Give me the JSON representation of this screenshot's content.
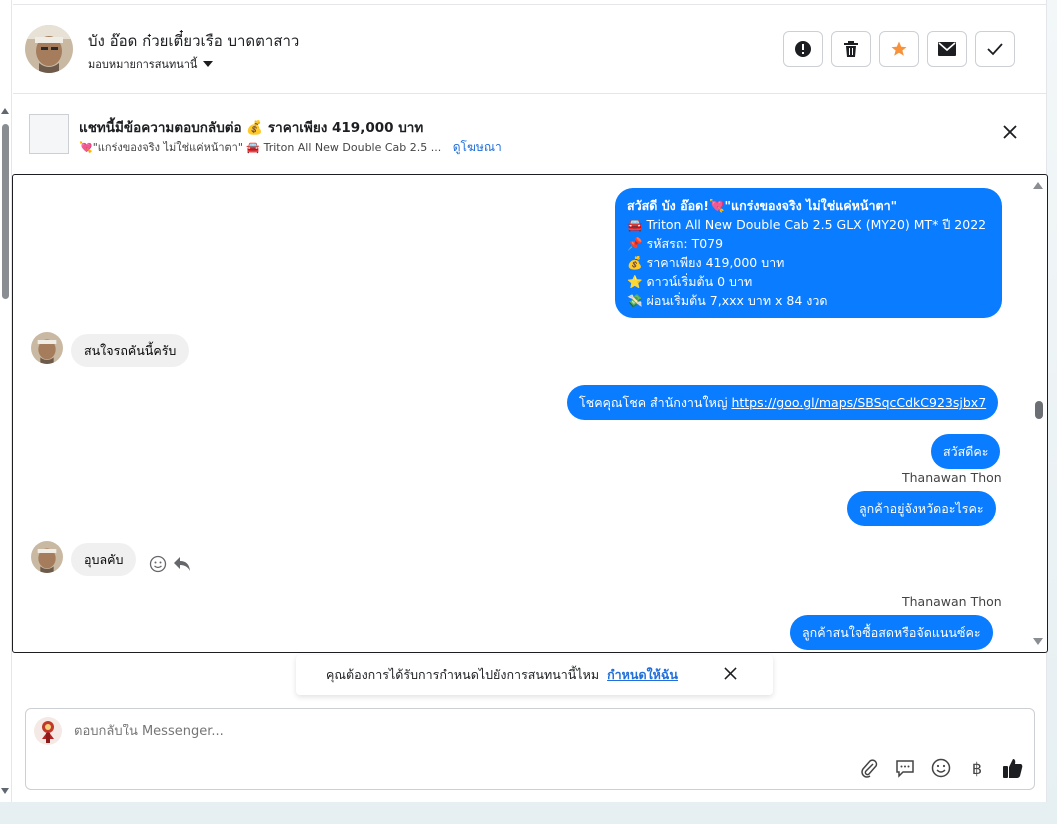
{
  "header": {
    "contact_name": "บัง อ๊อด ก๋วยเตี๋ยวเรือ บาดตาสาว",
    "assign_label": "มอบหมายการสนทนานี้"
  },
  "ad": {
    "title": "แชทนี้มีข้อความตอบกลับต่อ 💰 ราคาเพียง 419,000 บาท",
    "subtitle": "💘\"แกร่งของจริง ไม่ใช่แค่หน้าตา\" 🚘 Triton All New Double Cab 2.5 ...",
    "link": "ดูโฆษณา"
  },
  "messages": {
    "m1": {
      "line1": "สวัสดี บัง อ๊อด!💘\"แกร่งของจริง ไม่ใช่แค่หน้าตา\"",
      "line2": "🚘 Triton All New Double Cab 2.5 GLX (MY20) MT*  ปี 2022",
      "line3": "📌 รหัสรถ: T079",
      "line4": "💰 ราคาเพียง 419,000 บาท",
      "line5": "⭐ ดาวน์เริ่มต้น 0 บาท",
      "line6": "💸 ผ่อนเริ่มต้น 7,xxx บาท x 84 งวด"
    },
    "m2": "สนใจรถคันนี้ครับ",
    "m3_prefix": "โชคคุณโชค สำนักงานใหญ่ ",
    "m3_link": "https://goo.gl/maps/SBSqcCdkC923sjbx7",
    "m4": "สวัสดีคะ",
    "sender1": "Thanawan Thon",
    "m5": "ลูกค้าอยู่จังหวัดอะไรคะ",
    "m6": "อุบลคับ",
    "sender2": "Thanawan Thon",
    "m7": "ลูกค้าสนใจซื้อสดหรือจัดแนนซ์คะ"
  },
  "assign_prompt": {
    "text": "คุณต้องการได้รับการกำหนดไปยังการสนทนานี้ไหม",
    "action": "กำหนดให้ฉัน"
  },
  "composer": {
    "placeholder": "ตอบกลับใน Messenger..."
  },
  "icons": {
    "currency": "฿"
  }
}
